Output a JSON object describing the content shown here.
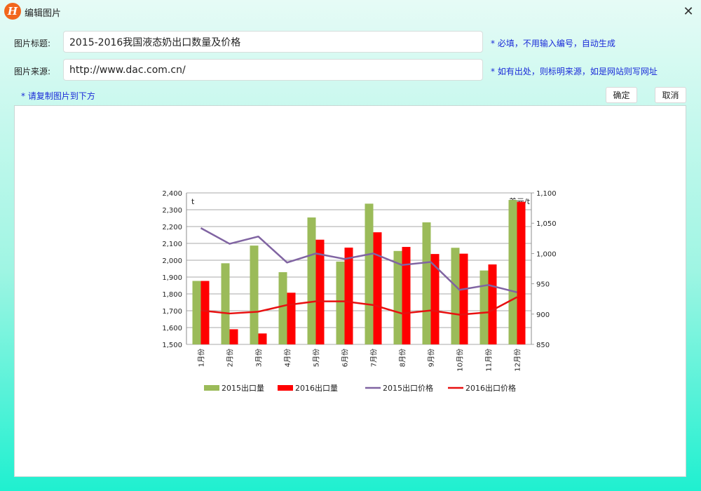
{
  "window": {
    "title": "编辑图片",
    "logo_letter": "H",
    "close_glyph": "✕"
  },
  "form": {
    "title_label": "图片标题:",
    "title_value": "2015-2016我国液态奶出口数量及价格",
    "title_hint": "* 必填，不用输入编号，自动生成",
    "source_label": "图片来源:",
    "source_value": "http://www.dac.com.cn/",
    "source_hint": "* 如有出处，则标明来源，如是网站则写网址",
    "paste_hint": "* 请复制图片到下方",
    "confirm_label": "确定",
    "cancel_label": "取消"
  },
  "colors": {
    "series_2015_bar": "#9bbb59",
    "series_2016_bar": "#ff0000",
    "series_2015_line": "#8064a2",
    "series_2016_line": "#e81010"
  },
  "chart_data": {
    "type": "bar",
    "categories": [
      "1月份",
      "2月份",
      "3月份",
      "4月份",
      "5月份",
      "6月份",
      "7月份",
      "8月份",
      "9月份",
      "10月份",
      "11月份",
      "12月份"
    ],
    "y_left": {
      "unit_label": "t",
      "ylim": [
        1500,
        2400
      ],
      "ticks": [
        "1,500",
        "1,600",
        "1,700",
        "1,800",
        "1,900",
        "2,000",
        "2,100",
        "2,200",
        "2,300",
        "2,400"
      ]
    },
    "y_right": {
      "unit_label": "美元/t",
      "ylim": [
        850,
        1100
      ],
      "ticks": [
        "850",
        "900",
        "950",
        "1,000",
        "1,050",
        "1,100"
      ]
    },
    "series": [
      {
        "name": "2015出口量",
        "kind": "bar",
        "axis": "left",
        "values": [
          1877,
          1982,
          2087,
          1929,
          2254,
          1992,
          2336,
          2055,
          2225,
          2074,
          1939,
          2358
        ]
      },
      {
        "name": "2016出口量",
        "kind": "bar",
        "axis": "left",
        "values": [
          1877,
          1590,
          1565,
          1807,
          2122,
          2075,
          2166,
          2079,
          2037,
          2039,
          1975,
          2347
        ]
      },
      {
        "name": "2015出口价格",
        "kind": "line",
        "axis": "right",
        "values": [
          1042,
          1016,
          1028,
          985,
          1000,
          991,
          1000,
          981,
          986,
          940,
          948,
          936
        ]
      },
      {
        "name": "2016出口价格",
        "kind": "line",
        "axis": "right",
        "values": [
          906,
          901,
          904,
          915,
          921,
          921,
          915,
          901,
          906,
          899,
          903,
          928
        ]
      }
    ],
    "grid": true,
    "legend_position": "bottom"
  }
}
